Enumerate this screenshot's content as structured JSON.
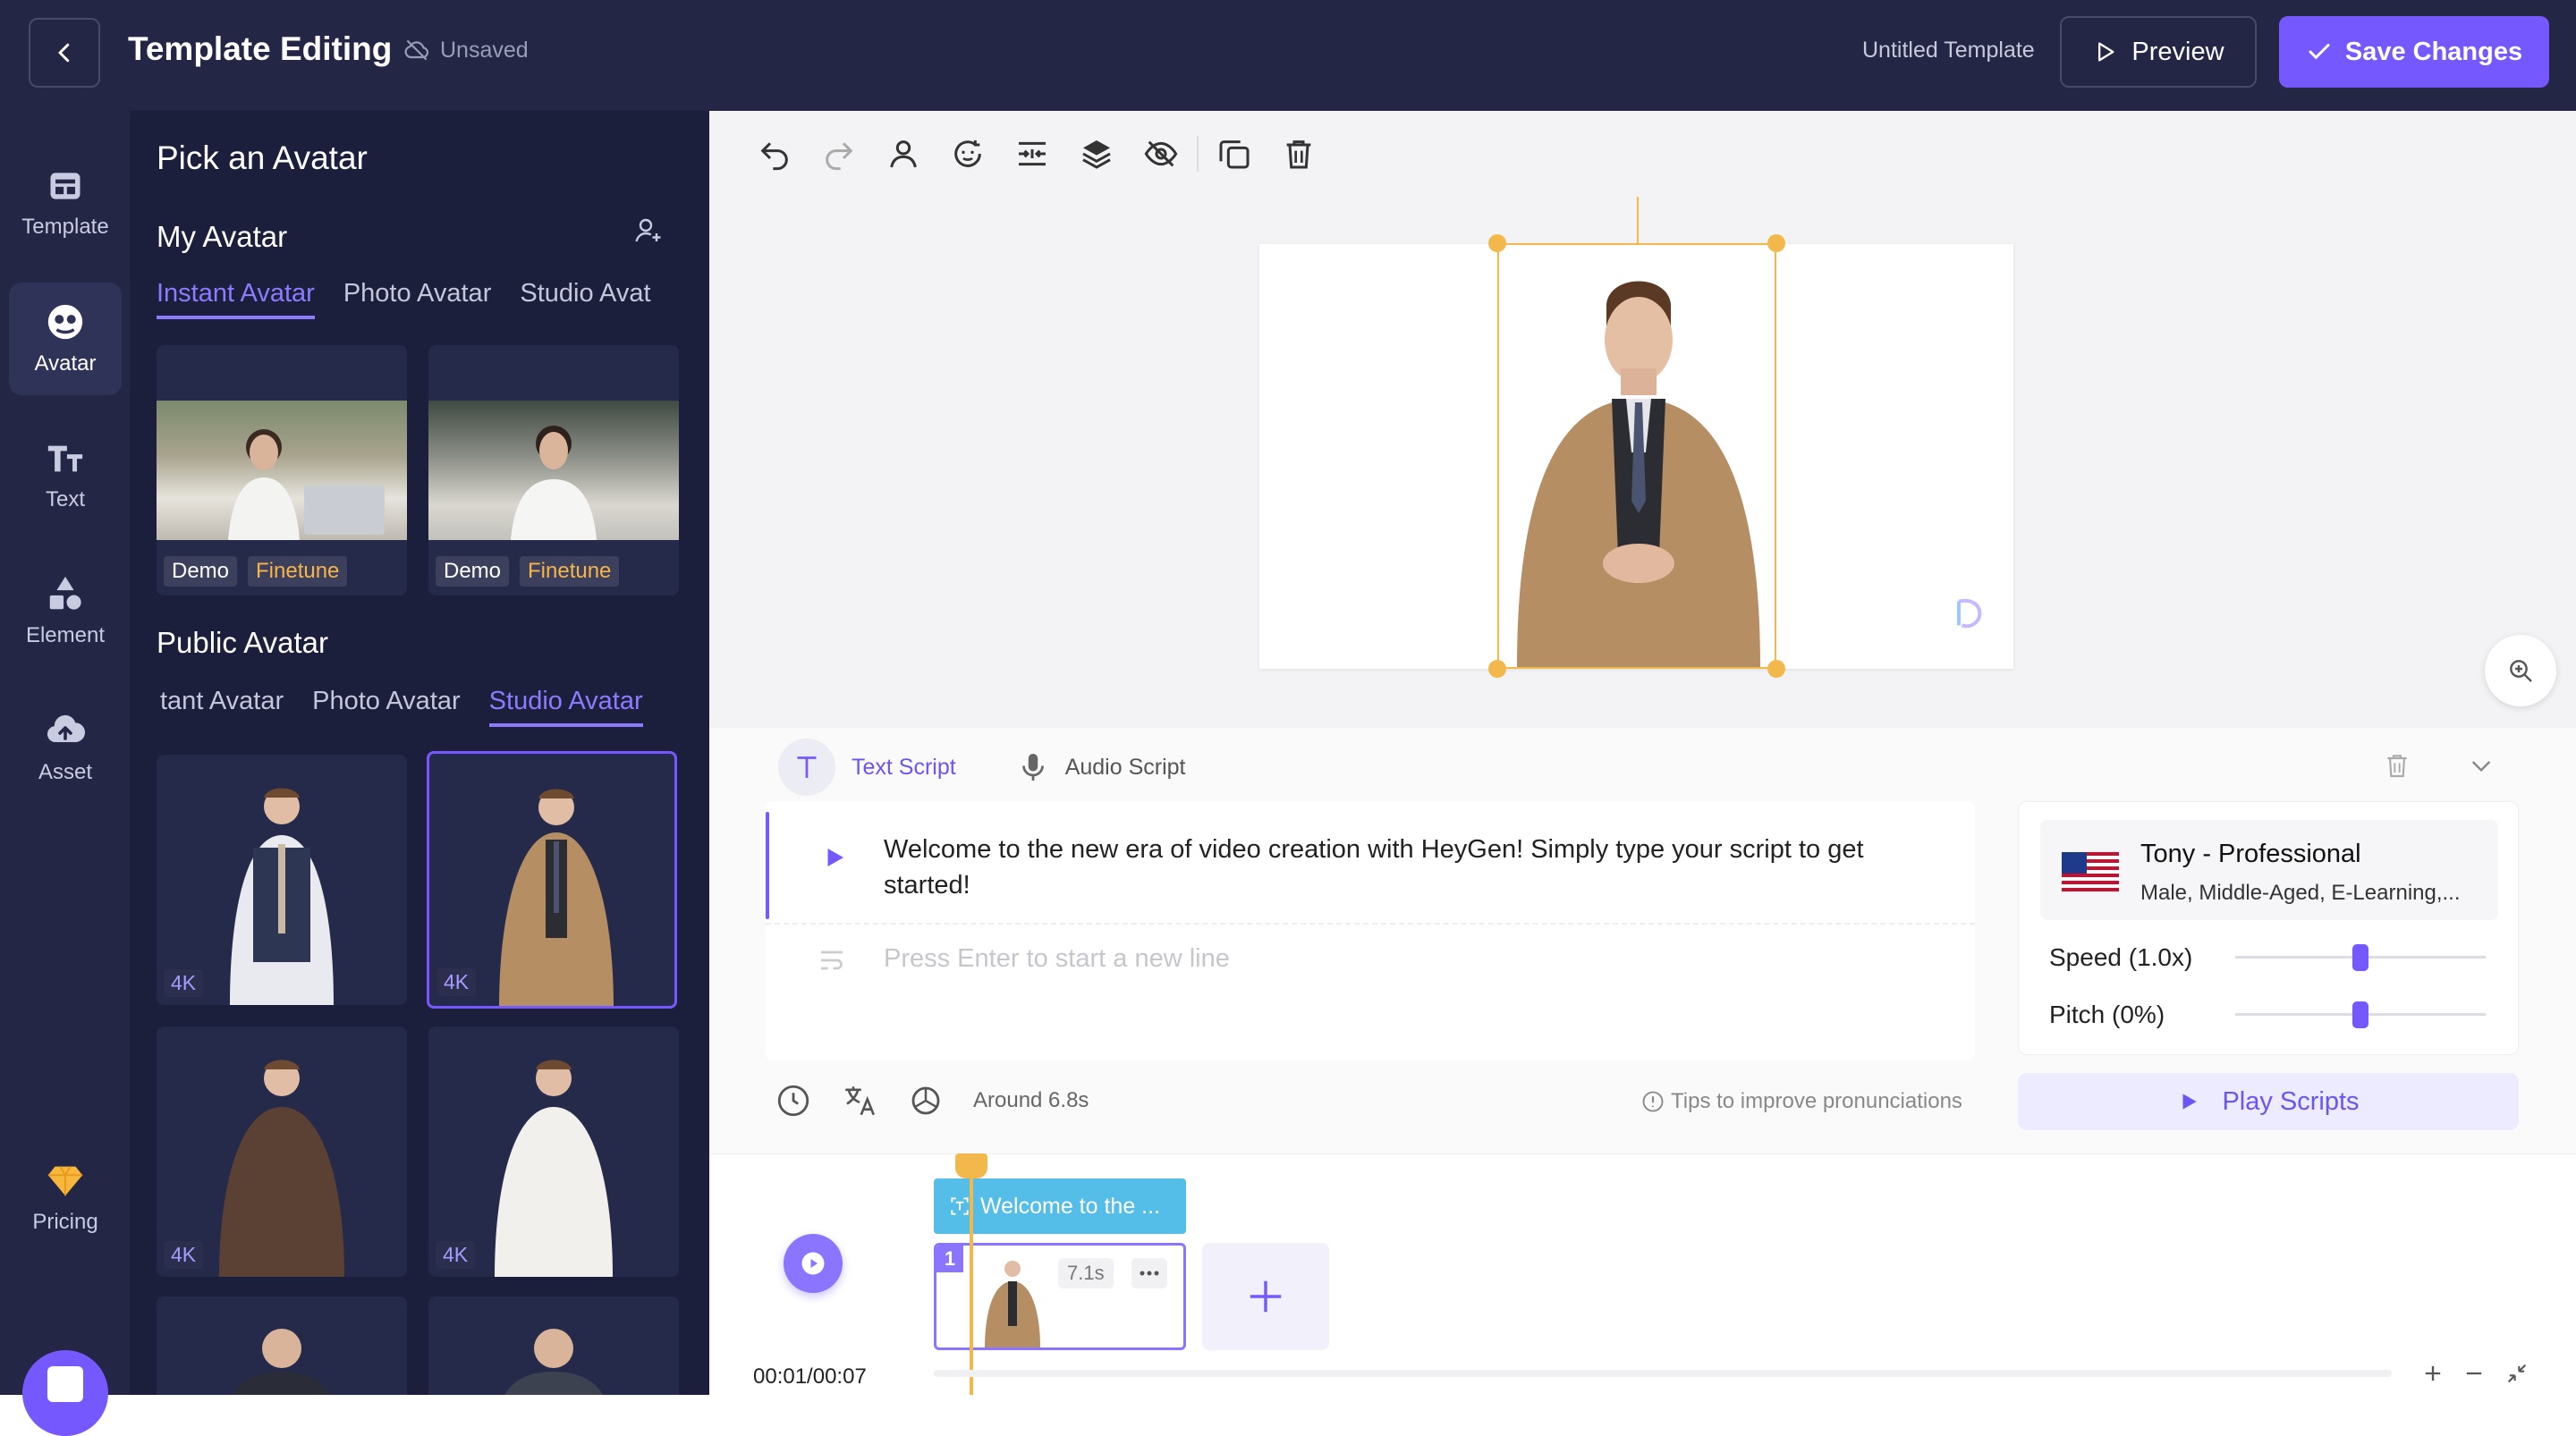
{
  "header": {
    "title": "Template Editing",
    "save_state": "Unsaved",
    "template_name": "Untitled Template",
    "preview_label": "Preview",
    "save_label": "Save Changes"
  },
  "rail": {
    "items": [
      {
        "label": "Template",
        "icon": "template-icon"
      },
      {
        "label": "Avatar",
        "icon": "avatar-icon"
      },
      {
        "label": "Text",
        "icon": "text-icon"
      },
      {
        "label": "Element",
        "icon": "element-icon"
      },
      {
        "label": "Asset",
        "icon": "cloud-upload-icon"
      }
    ],
    "pricing_label": "Pricing"
  },
  "panel": {
    "title": "Pick an Avatar",
    "my_avatar": {
      "title": "My Avatar",
      "tabs": [
        "Instant Avatar",
        "Photo Avatar",
        "Studio Avat"
      ],
      "cards": [
        {
          "badge1": "Demo",
          "badge2": "Finetune"
        },
        {
          "badge1": "Demo",
          "badge2": "Finetune"
        }
      ]
    },
    "public_avatar": {
      "title": "Public Avatar",
      "tabs": [
        "tant Avatar",
        "Photo Avatar",
        "Studio Avatar"
      ],
      "cards": [
        {
          "badge": "4K"
        },
        {
          "badge": "4K"
        },
        {
          "badge": "4K"
        },
        {
          "badge": "4K"
        }
      ]
    }
  },
  "script": {
    "tab_text": "Text Script",
    "tab_audio": "Audio Script",
    "line1": "Welcome to the new era of video creation with HeyGen! Simply type your script to get started!",
    "placeholder": "Press Enter to start a new line",
    "duration": "Around 6.8s",
    "tips": "Tips to improve pronunciations"
  },
  "voice": {
    "name": "Tony - Professional",
    "desc": "Male, Middle-Aged, E-Learning,...",
    "speed_label": "Speed (1.0x)",
    "pitch_label": "Pitch (0%)",
    "speed_value": 0.5,
    "pitch_value": 0.5,
    "play_label": "Play Scripts"
  },
  "timeline": {
    "text_clip": "Welcome to the ...",
    "scene_number": "1",
    "scene_duration": "7.1s",
    "time": "00:01/00:07"
  },
  "colors": {
    "accent": "#7559ff",
    "dark_bg": "#232645",
    "panel_bg": "#1c1f3b",
    "selection": "#f3b84c"
  }
}
